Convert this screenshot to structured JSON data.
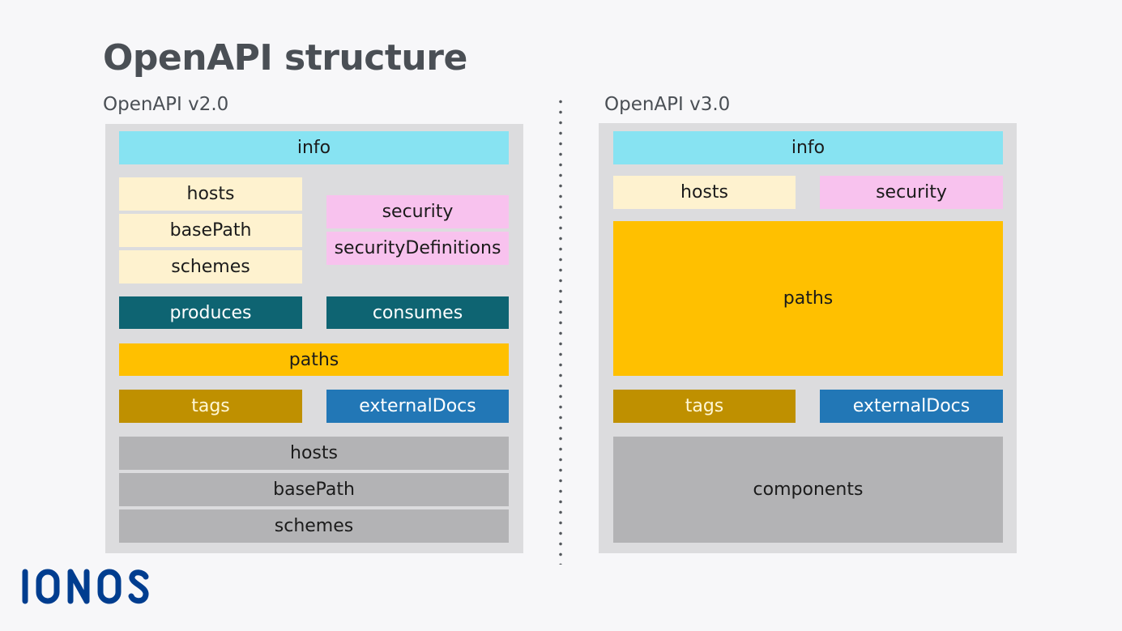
{
  "title": "OpenAPI structure",
  "v2": {
    "label": "OpenAPI v2.0",
    "blocks": {
      "info": "info",
      "hosts": "hosts",
      "basePath": "basePath",
      "schemes": "schemes",
      "security": "security",
      "securityDefinitions": "securityDefinitions",
      "produces": "produces",
      "consumes": "consumes",
      "paths": "paths",
      "tags": "tags",
      "externalDocs": "externalDocs",
      "hosts2": "hosts",
      "basePath2": "basePath",
      "schemes2": "schemes"
    }
  },
  "v3": {
    "label": "OpenAPI v3.0",
    "blocks": {
      "info": "info",
      "hosts": "hosts",
      "security": "security",
      "paths": "paths",
      "tags": "tags",
      "externalDocs": "externalDocs",
      "components": "components"
    }
  },
  "colors": {
    "info": "#87e3f2",
    "server": "#fef2cf",
    "security": "#f8c2ee",
    "mime": "#0e6472",
    "paths": "#ffc000",
    "tags": "#bf9000",
    "externalDocs": "#2277b6",
    "reusable": "#b3b3b5",
    "brand": "#003d8f"
  },
  "brand": {
    "logo_text": "IONOS"
  }
}
